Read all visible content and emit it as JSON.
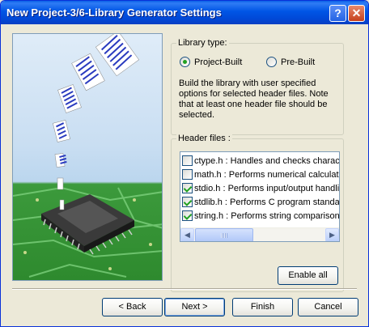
{
  "window": {
    "title": "New Project-3/6-Library Generator Settings",
    "help_label": "?",
    "close_label": "✕"
  },
  "library_type": {
    "legend": "Library type:",
    "options": [
      {
        "label": "Project-Built",
        "checked": true
      },
      {
        "label": "Pre-Built",
        "checked": false
      }
    ],
    "description": "Build the library with user specified options for selected header files. Note that at least one header file should be selected."
  },
  "header_files": {
    "legend": "Header files :",
    "items": [
      {
        "label": "ctype.h : Handles and checks charac",
        "checked": false
      },
      {
        "label": "math.h : Performs numerical calculatio",
        "checked": false
      },
      {
        "label": "stdio.h : Performs input/output handlin",
        "checked": true
      },
      {
        "label": "stdlib.h : Performs C program standard",
        "checked": true
      },
      {
        "label": "string.h : Performs string comparison, c",
        "checked": true
      }
    ],
    "enable_all_label": "Enable all"
  },
  "footer": {
    "back_label": "< Back",
    "next_label": "Next >",
    "finish_label": "Finish",
    "cancel_label": "Cancel"
  },
  "colors": {
    "titlebar": "#0055E5",
    "check_green": "#21A121",
    "dialog_bg": "#ECE9D8"
  }
}
